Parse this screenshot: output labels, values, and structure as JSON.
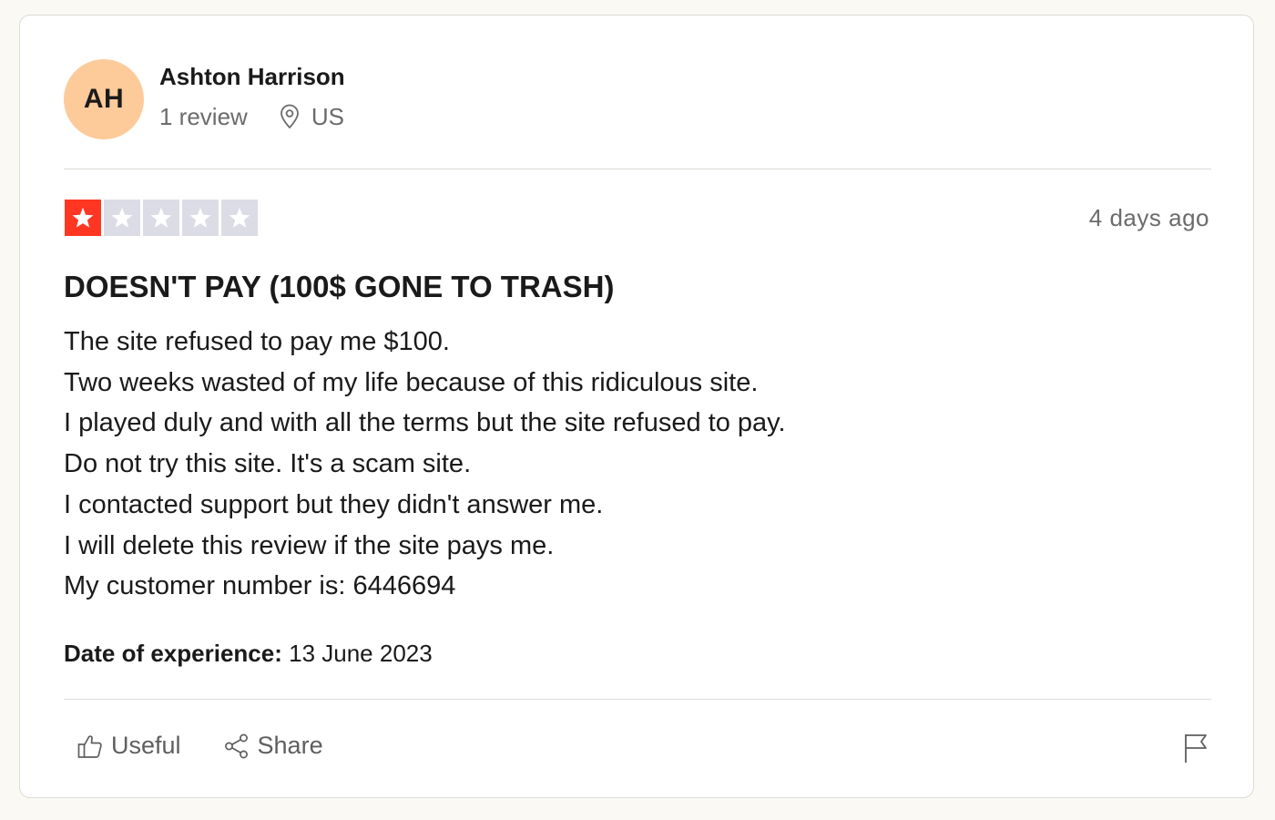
{
  "reviewer": {
    "initials": "AH",
    "name": "Ashton Harrison",
    "review_count": "1 review",
    "country": "US",
    "avatar_color": "#fdca9a"
  },
  "review": {
    "rating": 1,
    "rating_max": 5,
    "posted": "4 days ago",
    "title": "DOESN'T PAY (100$ GONE TO TRASH)",
    "body_lines": [
      "The site refused to pay me $100.",
      "Two weeks wasted of my life because of this ridiculous site.",
      "I played duly and with all the terms but the site refused to pay.",
      "Do not try this site. It's a scam site.",
      "I contacted support but they didn't answer me.",
      "I will delete this review if the site pays me.",
      "My customer number is: 6446694"
    ],
    "experience_label": "Date of experience:",
    "experience_date": "13 June 2023"
  },
  "actions": {
    "useful_label": "Useful",
    "share_label": "Share"
  },
  "icons": {
    "location": "location-pin-icon",
    "star": "star-icon",
    "useful": "thumbs-up-icon",
    "share": "share-icon",
    "report": "flag-icon"
  },
  "colors": {
    "star_filled": "#ff3722",
    "star_empty": "#dcdce6",
    "muted_text": "#6b6b6b"
  }
}
